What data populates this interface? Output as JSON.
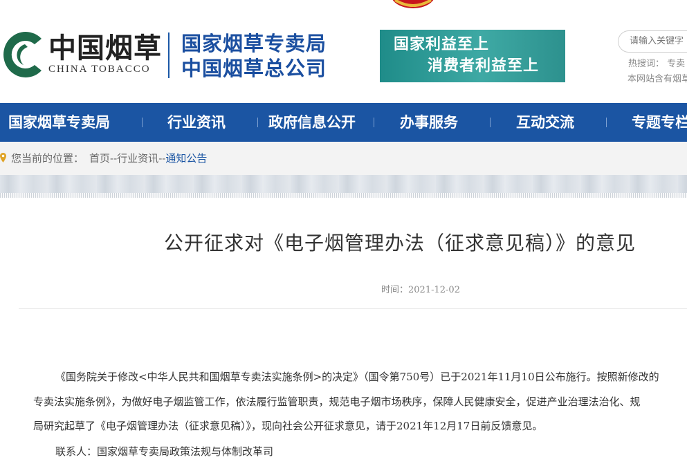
{
  "header": {
    "logo_cn": "中国烟草",
    "logo_en": "CHINA TOBACCO",
    "org_line1": "国家烟草专卖局",
    "org_line2": "中国烟草总公司",
    "slogan_line1": "国家利益至上",
    "slogan_line2": "消费者利益至上",
    "search_placeholder": "请输入关键字",
    "hot_search": "热搜词：  专卖",
    "site_notice": "本网站含有烟草"
  },
  "nav": {
    "items": [
      "国家烟草专卖局",
      "行业资讯",
      "政府信息公开",
      "办事服务",
      "互动交流",
      "专题专栏"
    ]
  },
  "breadcrumb": {
    "label": "您当前的位置：",
    "home": "首页",
    "sep1": "--",
    "section": "行业资讯",
    "sep2": "--",
    "current": "通知公告"
  },
  "article": {
    "title": "公开征求对《电子烟管理办法（征求意见稿）》的意见",
    "date_label": "时间：",
    "date": "2021-12-02",
    "line1": "《国务院关于修改<中华人民共和国烟草专卖法实施条例>的决定》（国令第750号）已于2021年11月10日公布施行。按照新修改的",
    "line2": "专卖法实施条例》，为做好电子烟监管工作，依法履行监管职责，规范电子烟市场秩序，保障人民健康安全，促进产业治理法治化、规",
    "line3": "局研究起草了《电子烟管理办法（征求意见稿）》，现向社会公开征求意见，请于2021年12月17日前反馈意见。",
    "contact": "联系人：国家烟草专卖局政策法规与体制改革司"
  },
  "colors": {
    "brand_blue": "#1b55a3",
    "logo_green": "#1f6a4a",
    "slogan_teal": "#2f9c98"
  }
}
